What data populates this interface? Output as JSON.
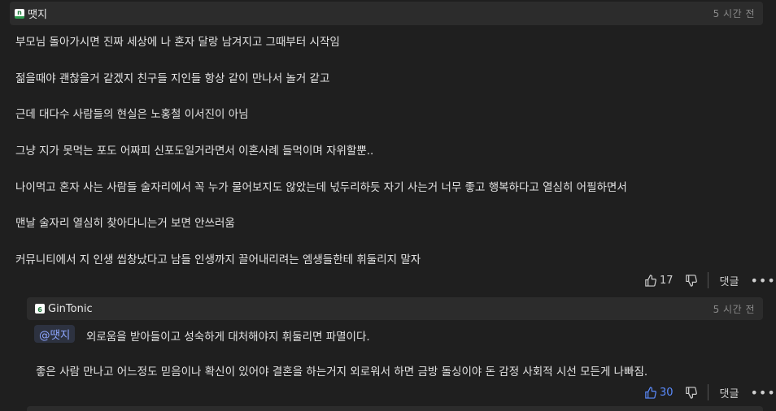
{
  "comment": {
    "author": "땟지",
    "author_badge": "n",
    "time": "5 시간 전",
    "lines": [
      "부모님 돌아가시면 진짜 세상에 나 혼자 달랑 남겨지고 그때부터 시작임",
      "젊을때야 괜찮을거 같겠지 친구들 지인들 항상 같이 만나서 놀거 같고",
      "근데 대다수 사람들의 현실은 노홍철 이서진이 아님",
      "그냥 지가 못먹는 포도 어짜피 신포도일거라면서 이혼사례 들먹이며 자위할뿐..",
      "나이먹고 혼자 사는 사람들 술자리에서 꼭 누가 물어보지도 않았는데 넋두리하듯 자기 사는거 너무 좋고 행복하다고 열심히 어필하면서",
      "맨날 술자리 열심히 찾아다니는거 보면 안쓰러움",
      "커뮤니티에서 지 인생 씹창났다고 남들 인생까지 끌어내리려는 엠생들한테 휘둘리지 말자"
    ],
    "likes": "17",
    "reply_label": "댓글",
    "more": "•••"
  },
  "reply": {
    "author": "GinTonic",
    "author_badge": "6",
    "time": "5 시간 전",
    "mention": "@땟지",
    "line1": "외로움을 받아들이고 성숙하게 대처해야지 휘둘리면 파멸이다.",
    "line2": "좋은 사람 만나고 어느정도 믿음이나 확신이 있어야 결혼을 하는거지 외로워서 하면 금방 돌싱이야 돈 감정 사회적 시선 모든게 나빠짐.",
    "likes": "30",
    "reply_label": "댓글",
    "more": "•••"
  },
  "colors": {
    "accent": "#5b8cff",
    "background": "#1f1f1f",
    "header": "#2c2c2c"
  },
  "icons": [
    "thumbs-up-icon",
    "thumbs-down-icon",
    "more-icon"
  ]
}
